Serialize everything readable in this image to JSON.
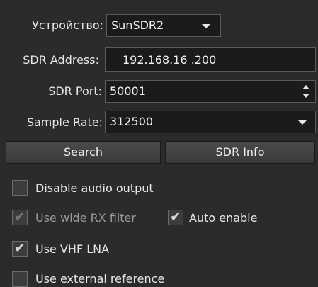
{
  "device": {
    "label": "Устройство:",
    "value": "SunSDR2"
  },
  "address": {
    "label": "SDR Address:",
    "value": "192.168.16 .200"
  },
  "port": {
    "label": "SDR Port:",
    "value": "50001"
  },
  "sample_rate": {
    "label": "Sample Rate:",
    "value": "312500"
  },
  "buttons": {
    "search": "Search",
    "sdr_info": "SDR Info"
  },
  "options": {
    "disable_audio": {
      "label": "Disable audio output",
      "checked": false,
      "enabled": true
    },
    "wide_rx": {
      "label": "Use wide RX filter",
      "checked": true,
      "enabled": false
    },
    "auto_enable": {
      "label": "Auto enable",
      "checked": true,
      "enabled": true
    },
    "vhf_lna": {
      "label": "Use VHF LNA",
      "checked": true,
      "enabled": true
    },
    "external_ref": {
      "label": "Use external reference",
      "checked": false,
      "enabled": true
    }
  }
}
